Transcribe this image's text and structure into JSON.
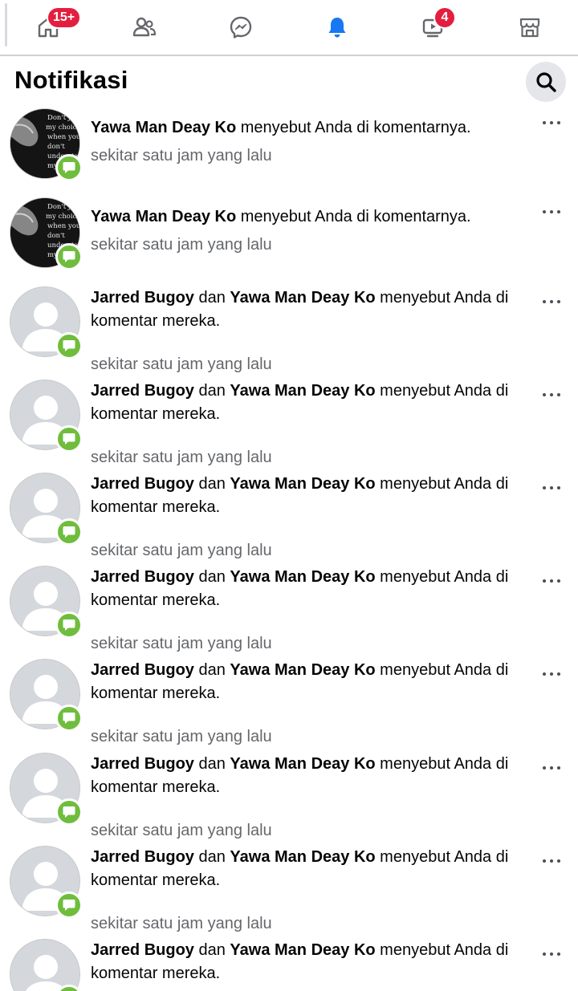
{
  "nav": {
    "home_badge": "15+",
    "watch_badge": "4",
    "icons": [
      "home-icon",
      "friends-icon",
      "messenger-icon",
      "bell-icon",
      "watch-icon",
      "marketplace-icon"
    ],
    "accent": "#1877f2",
    "icon_color": "#65676b"
  },
  "header": {
    "title": "Notifikasi"
  },
  "colors": {
    "badge_red": "#e41e3f",
    "comment_green": "#6fbd3c",
    "muted_text": "#65676b"
  },
  "notifications": [
    {
      "actor1": "Yawa Man Deay Ko",
      "conj": "",
      "actor2": "",
      "text": " menyebut Anda di komentarnya.",
      "time": "sekitar satu jam yang lalu",
      "avatar": "photo",
      "avatar_text": [
        "Don't judge",
        "my choices",
        "when you",
        "don't",
        "understand",
        "my reasons"
      ]
    },
    {
      "actor1": "Yawa Man Deay Ko",
      "conj": "",
      "actor2": "",
      "text": " menyebut Anda di komentarnya.",
      "time": "sekitar satu jam yang lalu",
      "avatar": "photo",
      "avatar_text": [
        "Don't judge",
        "my choices",
        "when you",
        "don't",
        "understand",
        "my reasons"
      ]
    },
    {
      "actor1": "Jarred Bugoy",
      "conj": " dan ",
      "actor2": "Yawa Man Deay Ko",
      "text": " menyebut Anda di komentar mereka.",
      "time": "sekitar satu jam yang lalu",
      "avatar": "default"
    },
    {
      "actor1": "Jarred Bugoy",
      "conj": " dan ",
      "actor2": "Yawa Man Deay Ko",
      "text": " menyebut Anda di komentar mereka.",
      "time": "sekitar satu jam yang lalu",
      "avatar": "default"
    },
    {
      "actor1": "Jarred Bugoy",
      "conj": " dan ",
      "actor2": "Yawa Man Deay Ko",
      "text": " menyebut Anda di komentar mereka.",
      "time": "sekitar satu jam yang lalu",
      "avatar": "default"
    },
    {
      "actor1": "Jarred Bugoy",
      "conj": " dan ",
      "actor2": "Yawa Man Deay Ko",
      "text": " menyebut Anda di komentar mereka.",
      "time": "sekitar satu jam yang lalu",
      "avatar": "default"
    },
    {
      "actor1": "Jarred Bugoy",
      "conj": " dan ",
      "actor2": "Yawa Man Deay Ko",
      "text": " menyebut Anda di komentar mereka.",
      "time": "sekitar satu jam yang lalu",
      "avatar": "default"
    },
    {
      "actor1": "Jarred Bugoy",
      "conj": " dan ",
      "actor2": "Yawa Man Deay Ko",
      "text": " menyebut Anda di komentar mereka.",
      "time": "sekitar satu jam yang lalu",
      "avatar": "default"
    },
    {
      "actor1": "Jarred Bugoy",
      "conj": " dan ",
      "actor2": "Yawa Man Deay Ko",
      "text": " menyebut Anda di komentar mereka.",
      "time": "sekitar satu jam yang lalu",
      "avatar": "default"
    },
    {
      "actor1": "Jarred Bugoy",
      "conj": " dan ",
      "actor2": "Yawa Man Deay Ko",
      "text": " menyebut Anda di komentar mereka.",
      "time": "",
      "avatar": "default"
    }
  ]
}
